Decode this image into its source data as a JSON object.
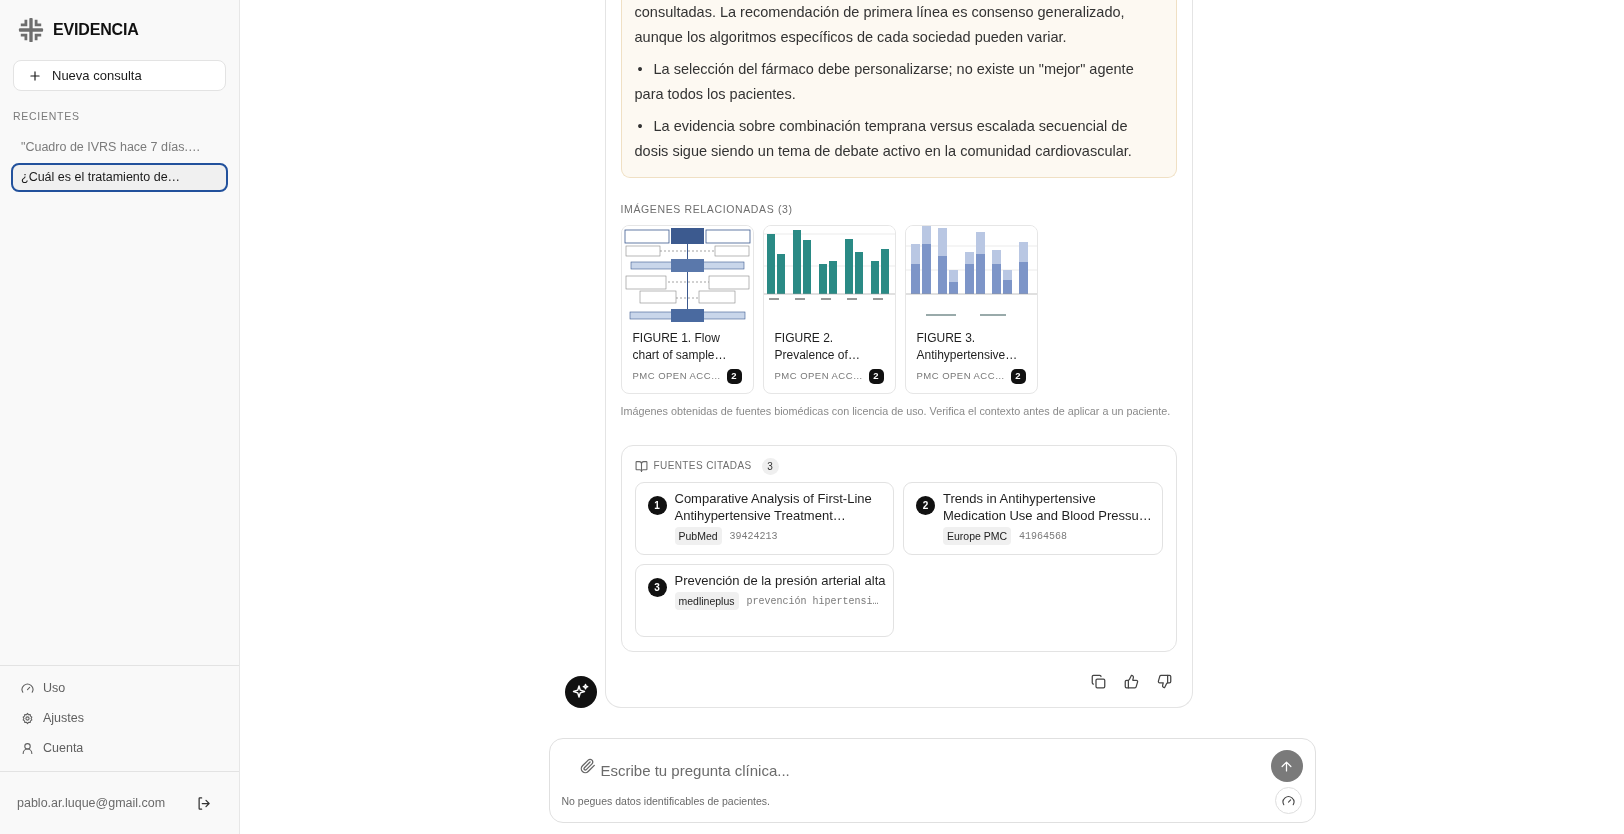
{
  "sidebar": {
    "brand": "EVIDENCIA",
    "new_query_button": "Nueva consulta",
    "recents_heading": "RECIENTES",
    "recents": [
      {
        "label": "\"Cuadro de IVRS hace 7 días.…",
        "selected": false
      },
      {
        "label": "¿Cuál es el tratamiento de…",
        "selected": true
      }
    ],
    "menu": [
      "Uso",
      "Ajustes",
      "Cuenta"
    ],
    "account_email": "pablo.ar.luque@gmail.com"
  },
  "answer": {
    "summary": [
      {
        "kind": "text",
        "text": "consultadas. La recomendación de primera línea es consenso generalizado, aunque los algoritmos específicos de cada sociedad pueden variar."
      },
      {
        "kind": "bullet",
        "marker": "•",
        "text": "La selección del fármaco debe personalizarse; no existe un \"mejor\" agente para todos los pacientes."
      },
      {
        "kind": "bullet",
        "marker": "•",
        "text": "La evidencia sobre combinación temprana versus escalada secuencial de dosis sigue siendo un tema de debate activo en la comunidad cardiovascular."
      }
    ],
    "images_heading": "IMÁGENES RELACIONADAS (3)",
    "images": [
      {
        "kind": "flowchart",
        "title": "FIGURE 1. Flow chart of sample…",
        "source": "PMC OPEN ACC…",
        "count": "2"
      },
      {
        "kind": "bar_chart",
        "title": "FIGURE 2. Prevalence of…",
        "source": "PMC OPEN ACC…",
        "count": "2"
      },
      {
        "kind": "stacked_bar_chart",
        "title": "FIGURE 3. Antihypertensive…",
        "source": "PMC OPEN ACC…",
        "count": "2"
      }
    ],
    "images_note": "Imágenes obtenidas de fuentes biomédicas con licencia de uso. Verifica el contexto antes de aplicar a un paciente.",
    "sources_heading": "FUENTES CITADAS",
    "sources_count": "3",
    "sources": [
      {
        "number": "1",
        "title": "Comparative Analysis of First-Line Antihypertensive Treatment…",
        "tag": "PubMed",
        "meta": "39424213"
      },
      {
        "number": "2",
        "title": "Trends in Antihypertensive Medication Use and Blood Pressu…",
        "tag": "Europe PMC",
        "meta": "41964568"
      },
      {
        "number": "3",
        "title": "Prevención de la presión arterial alta",
        "tag": "medlineplus",
        "meta": "prevención hipertensi…"
      }
    ]
  },
  "composer": {
    "placeholder": "Escribe tu pregunta clínica...",
    "note": "No pegues datos identificables de pacientes."
  }
}
